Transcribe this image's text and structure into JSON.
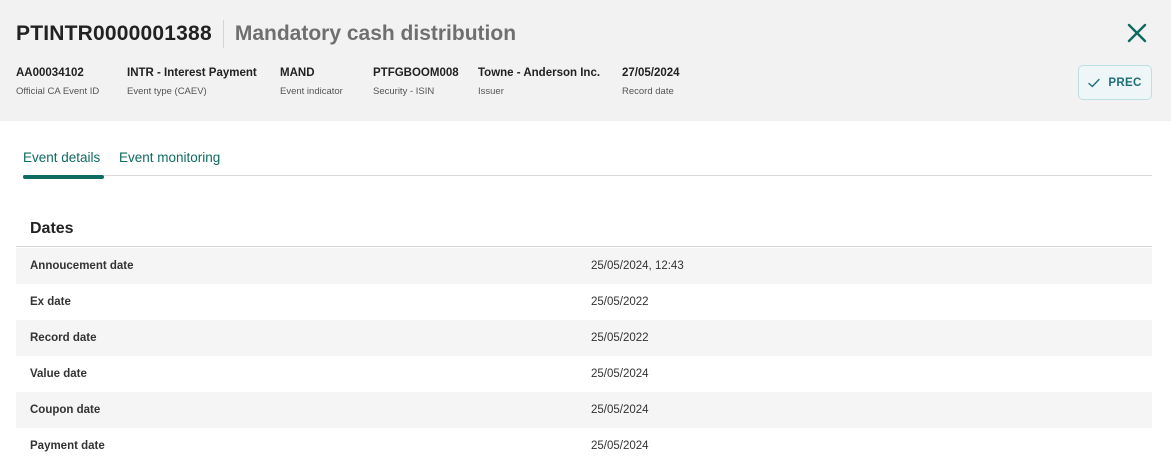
{
  "header": {
    "event_id": "PTINTR0000001388",
    "event_title": "Mandatory cash distribution",
    "close_icon": "close-icon",
    "meta": [
      {
        "value": "AA00034102",
        "label": "Official CA Event ID"
      },
      {
        "value": "INTR - Interest Payment",
        "label": "Event type (CAEV)"
      },
      {
        "value": "MAND",
        "label": "Event indicator"
      },
      {
        "value": "PTFGBOOM008",
        "label": "Security - ISIN"
      },
      {
        "value": "Towne - Anderson Inc.",
        "label": "Issuer"
      },
      {
        "value": "27/05/2024",
        "label": "Record date"
      }
    ],
    "status_button": {
      "label": "PREC",
      "icon": "check-icon"
    }
  },
  "tabs": [
    {
      "label": "Event details",
      "active": true
    },
    {
      "label": "Event monitoring",
      "active": false
    }
  ],
  "dates": {
    "title": "Dates",
    "rows": [
      {
        "label": "Annoucement date",
        "value": "25/05/2024, 12:43"
      },
      {
        "label": "Ex date",
        "value": "25/05/2022"
      },
      {
        "label": "Record date",
        "value": "25/05/2022"
      },
      {
        "label": "Value date",
        "value": "25/05/2024"
      },
      {
        "label": "Coupon date",
        "value": "25/05/2024"
      },
      {
        "label": "Payment date",
        "value": "25/05/2024"
      }
    ]
  },
  "colors": {
    "accent": "#0f6b61",
    "header_bg": "#f2f2f2",
    "status_button_bg": "#eef6f7",
    "status_button_text": "#1f6f7a"
  }
}
